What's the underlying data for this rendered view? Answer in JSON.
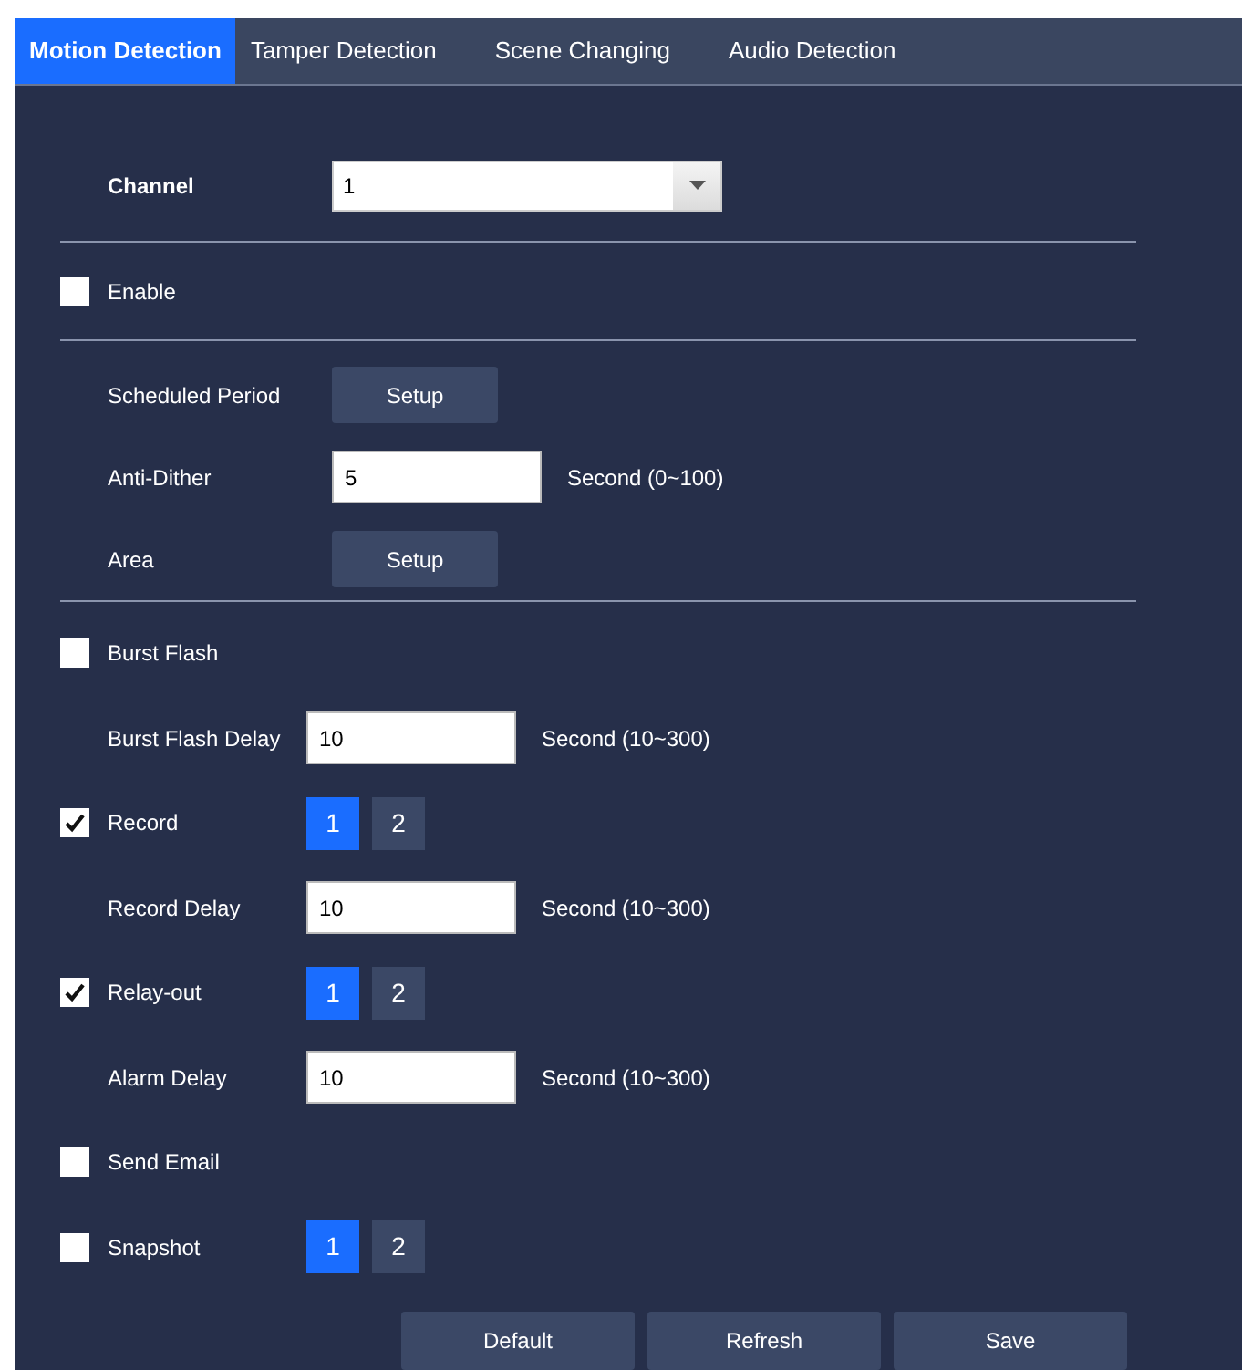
{
  "tabs": [
    {
      "label": "Motion Detection",
      "selected": true
    },
    {
      "label": "Tamper Detection",
      "selected": false
    },
    {
      "label": "Scene Changing",
      "selected": false
    },
    {
      "label": "Audio Detection",
      "selected": false
    }
  ],
  "sections": [
    {
      "rows": [
        {
          "kind": "select",
          "label": "Channel",
          "value": "1"
        }
      ]
    },
    {
      "rows": [
        {
          "kind": "checkbox",
          "label": "Enable",
          "checked": false
        }
      ]
    },
    {
      "rows": [
        {
          "kind": "button",
          "label": "Scheduled Period",
          "button": "Setup"
        },
        {
          "kind": "input",
          "label": "Anti-Dither",
          "value": "5",
          "unit": "Second (0~100)"
        },
        {
          "kind": "button",
          "label": "Area",
          "button": "Setup"
        }
      ]
    },
    {
      "rows": [
        {
          "kind": "checkbox",
          "label": "Burst Flash",
          "checked": false
        },
        {
          "kind": "input",
          "label": "Burst Flash Delay",
          "value": "10",
          "unit": "Second (10~300)"
        },
        {
          "kind": "channels",
          "label": "Record",
          "checked": true,
          "channels": [
            {
              "label": "1",
              "selected": true
            },
            {
              "label": "2",
              "selected": false
            }
          ]
        },
        {
          "kind": "input",
          "label": "Record Delay",
          "value": "10",
          "unit": "Second (10~300)"
        },
        {
          "kind": "channels",
          "label": "Relay-out",
          "checked": true,
          "channels": [
            {
              "label": "1",
              "selected": true
            },
            {
              "label": "2",
              "selected": false
            }
          ]
        },
        {
          "kind": "input",
          "label": "Alarm Delay",
          "value": "10",
          "unit": "Second (10~300)"
        },
        {
          "kind": "checkbox",
          "label": "Send Email",
          "checked": false
        },
        {
          "kind": "channels",
          "label": "Snapshot",
          "checked": false,
          "channels": [
            {
              "label": "1",
              "selected": true
            },
            {
              "label": "2",
              "selected": false
            }
          ]
        }
      ]
    }
  ],
  "buttons": [
    "Default",
    "Refresh",
    "Save"
  ]
}
